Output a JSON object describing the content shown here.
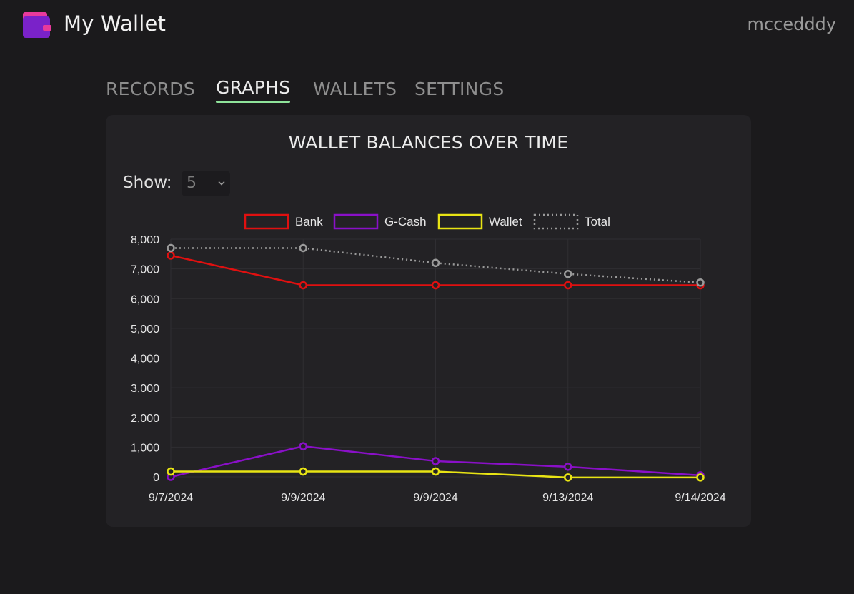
{
  "app": {
    "title": "My Wallet",
    "username": "mccedddy"
  },
  "tabs": [
    {
      "label": "RECORDS",
      "active": false
    },
    {
      "label": "GRAPHS",
      "active": true
    },
    {
      "label": "WALLETS",
      "active": false
    },
    {
      "label": "SETTINGS",
      "active": false
    }
  ],
  "card": {
    "title": "WALLET BALANCES OVER TIME",
    "show_label": "Show:",
    "show_value": "5"
  },
  "colors": {
    "background": "#1b1a1c",
    "card": "#232225",
    "tab_underline": "#8fe39a",
    "logo_back": "#e93a9c",
    "logo_front": "#7a22c9"
  },
  "chart_data": {
    "type": "line",
    "title": "WALLET BALANCES OVER TIME",
    "x": [
      "9/7/2024",
      "9/9/2024",
      "9/9/2024",
      "9/13/2024",
      "9/14/2024"
    ],
    "ylim": [
      0,
      8000
    ],
    "yticks": [
      "0",
      "1,000",
      "2,000",
      "3,000",
      "4,000",
      "5,000",
      "6,000",
      "7,000",
      "8,000"
    ],
    "grid": true,
    "legend_position": "top-center",
    "series": [
      {
        "name": "Bank",
        "color": "#e01010",
        "dashed": false,
        "values": [
          7450,
          6450,
          6450,
          6450,
          6450
        ]
      },
      {
        "name": "G-Cash",
        "color": "#8a10c8",
        "dashed": false,
        "values": [
          0,
          1030,
          530,
          340,
          50
        ]
      },
      {
        "name": "Wallet",
        "color": "#e8e414",
        "dashed": false,
        "values": [
          180,
          180,
          180,
          -20,
          -20
        ]
      },
      {
        "name": "Total",
        "color": "#9a9a9a",
        "dashed": true,
        "values": [
          7700,
          7700,
          7200,
          6830,
          6540
        ]
      }
    ]
  }
}
